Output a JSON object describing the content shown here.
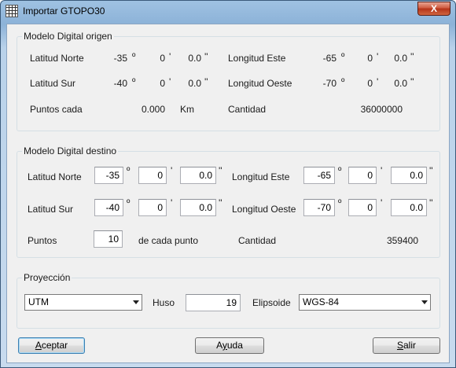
{
  "window": {
    "title": "Importar GTOPO30",
    "close_label": "X"
  },
  "origen": {
    "title": "Modelo Digital origen",
    "lat_norte": {
      "label": "Latitud Norte",
      "deg": "-35",
      "deg_sym": "º",
      "min": "0",
      "min_sym": "'",
      "sec": "0.0",
      "sec_sym": "''"
    },
    "lat_sur": {
      "label": "Latitud Sur",
      "deg": "-40",
      "deg_sym": "º",
      "min": "0",
      "min_sym": "'",
      "sec": "0.0",
      "sec_sym": "''"
    },
    "lon_este": {
      "label": "Longitud Este",
      "deg": "-65",
      "deg_sym": "º",
      "min": "0",
      "min_sym": "'",
      "sec": "0.0",
      "sec_sym": "''"
    },
    "lon_oeste": {
      "label": "Longitud Oeste",
      "deg": "-70",
      "deg_sym": "º",
      "min": "0",
      "min_sym": "'",
      "sec": "0.0",
      "sec_sym": "''"
    },
    "puntos_label": "Puntos cada",
    "puntos_value": "0.000",
    "puntos_unit": "Km",
    "cantidad_label": "Cantidad",
    "cantidad_value": "36000000"
  },
  "destino": {
    "title": "Modelo Digital destino",
    "lat_norte": {
      "label": "Latitud Norte",
      "deg": "-35",
      "min": "0",
      "sec": "0.0"
    },
    "lat_sur": {
      "label": "Latitud Sur",
      "deg": "-40",
      "min": "0",
      "sec": "0.0"
    },
    "lon_este": {
      "label": "Longitud Este",
      "deg": "-65",
      "min": "0",
      "sec": "0.0"
    },
    "lon_oeste": {
      "label": "Longitud Oeste",
      "deg": "-70",
      "min": "0",
      "sec": "0.0"
    },
    "deg_sym": "º",
    "min_sym": "'",
    "sec_sym": "''",
    "puntos_label": "Puntos",
    "puntos_value": "10",
    "puntos_suffix": "de cada punto",
    "cantidad_label": "Cantidad",
    "cantidad_value": "359400"
  },
  "proyeccion": {
    "title": "Proyección",
    "projection_value": "UTM",
    "huso_label": "Huso",
    "huso_value": "19",
    "elipsoide_label": "Elipsoide",
    "elipsoide_value": "WGS-84"
  },
  "buttons": {
    "aceptar_first": "A",
    "aceptar_rest": "ceptar",
    "ayuda_pre": "A",
    "ayuda_u": "y",
    "ayuda_rest": "uda",
    "salir_first": "S",
    "salir_rest": "alir"
  }
}
